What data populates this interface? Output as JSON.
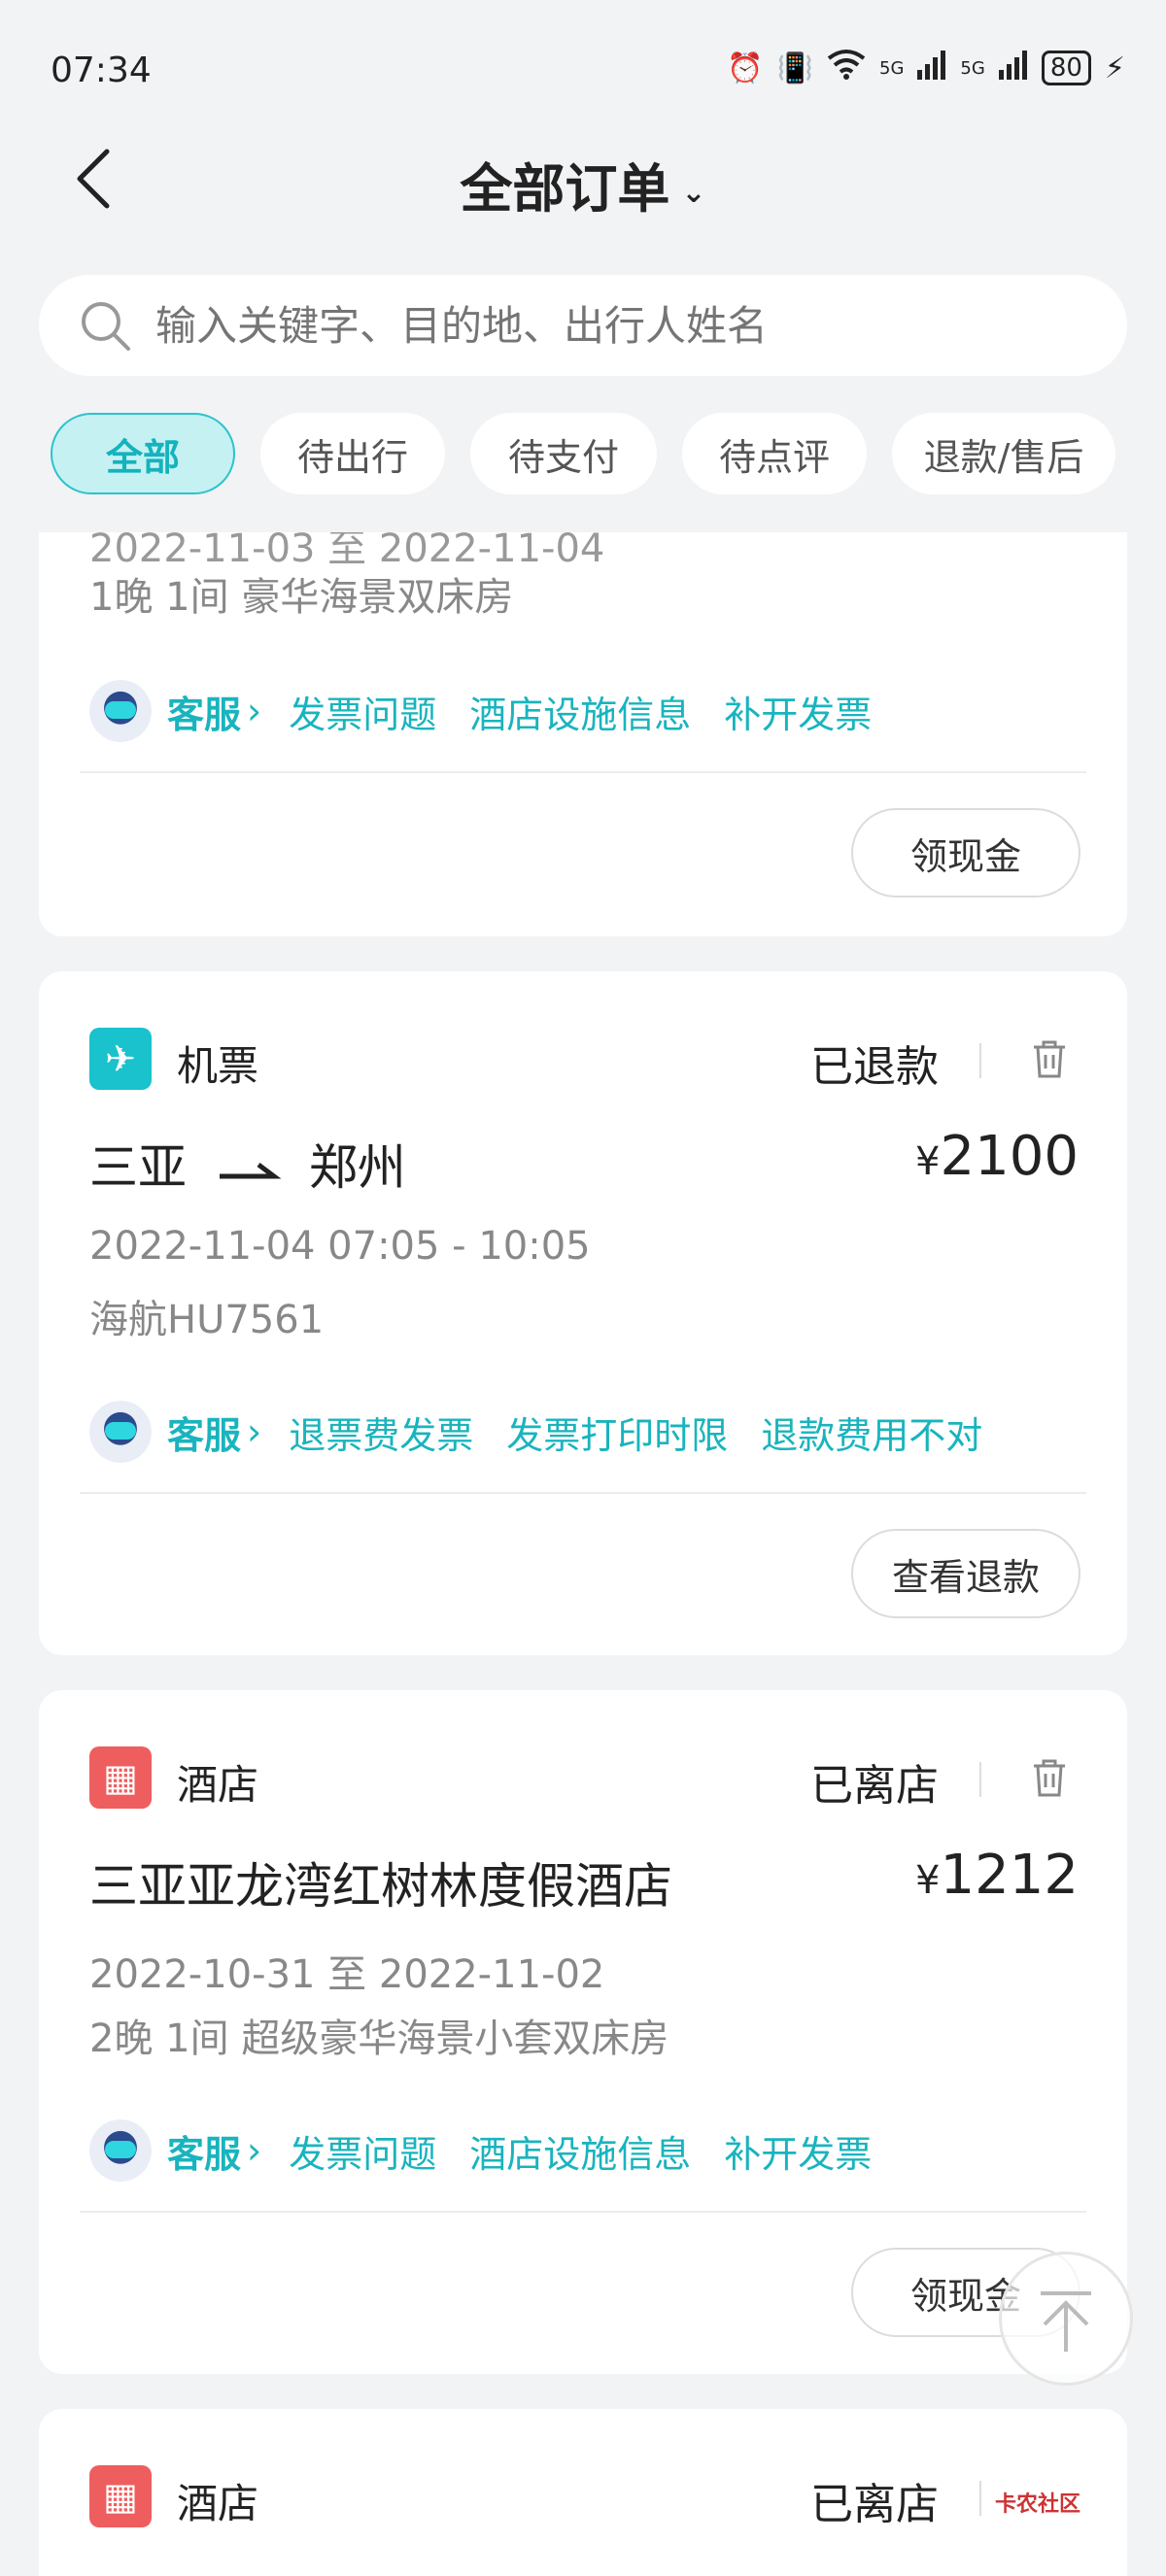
{
  "status_bar": {
    "time": "07:34",
    "signal1": "5G",
    "signal2": "5G",
    "battery": "80"
  },
  "header": {
    "title": "全部订单"
  },
  "search": {
    "placeholder": "输入关键字、目的地、出行人姓名"
  },
  "tabs": [
    {
      "label": "全部",
      "active": true
    },
    {
      "label": "待出行"
    },
    {
      "label": "待支付"
    },
    {
      "label": "待点评"
    },
    {
      "label": "退款/售后"
    }
  ],
  "card0": {
    "dates": "2022-11-03 至 2022-11-04",
    "room_info": "1晚  1间  豪华海景双床房",
    "service_label": "客服",
    "links": [
      "发票问题",
      "酒店设施信息",
      "补开发票"
    ],
    "button": "领现金"
  },
  "card1": {
    "type": "机票",
    "status": "已退款",
    "from": "三亚",
    "to": "郑州",
    "price_symbol": "¥",
    "price": "2100",
    "time": "2022-11-04 07:05 - 10:05",
    "flight": "海航HU7561",
    "service_label": "客服",
    "links": [
      "退票费发票",
      "发票打印时限",
      "退款费用不对"
    ],
    "button": "查看退款"
  },
  "card2": {
    "type": "酒店",
    "status": "已离店",
    "name": "三亚亚龙湾红树林度假酒店",
    "price_symbol": "¥",
    "price": "1212",
    "dates": "2022-10-31 至 2022-11-02",
    "room_info": "2晚  1间  超级豪华海景小套双床房",
    "service_label": "客服",
    "links": [
      "发票问题",
      "酒店设施信息",
      "补开发票"
    ],
    "button": "领现金"
  },
  "card3": {
    "type": "酒店",
    "status": "已离店"
  },
  "watermark": "卡农社区",
  "colors": {
    "accent": "#19b4be",
    "hotel": "#ee5e5e",
    "flight": "#19c2cc"
  }
}
